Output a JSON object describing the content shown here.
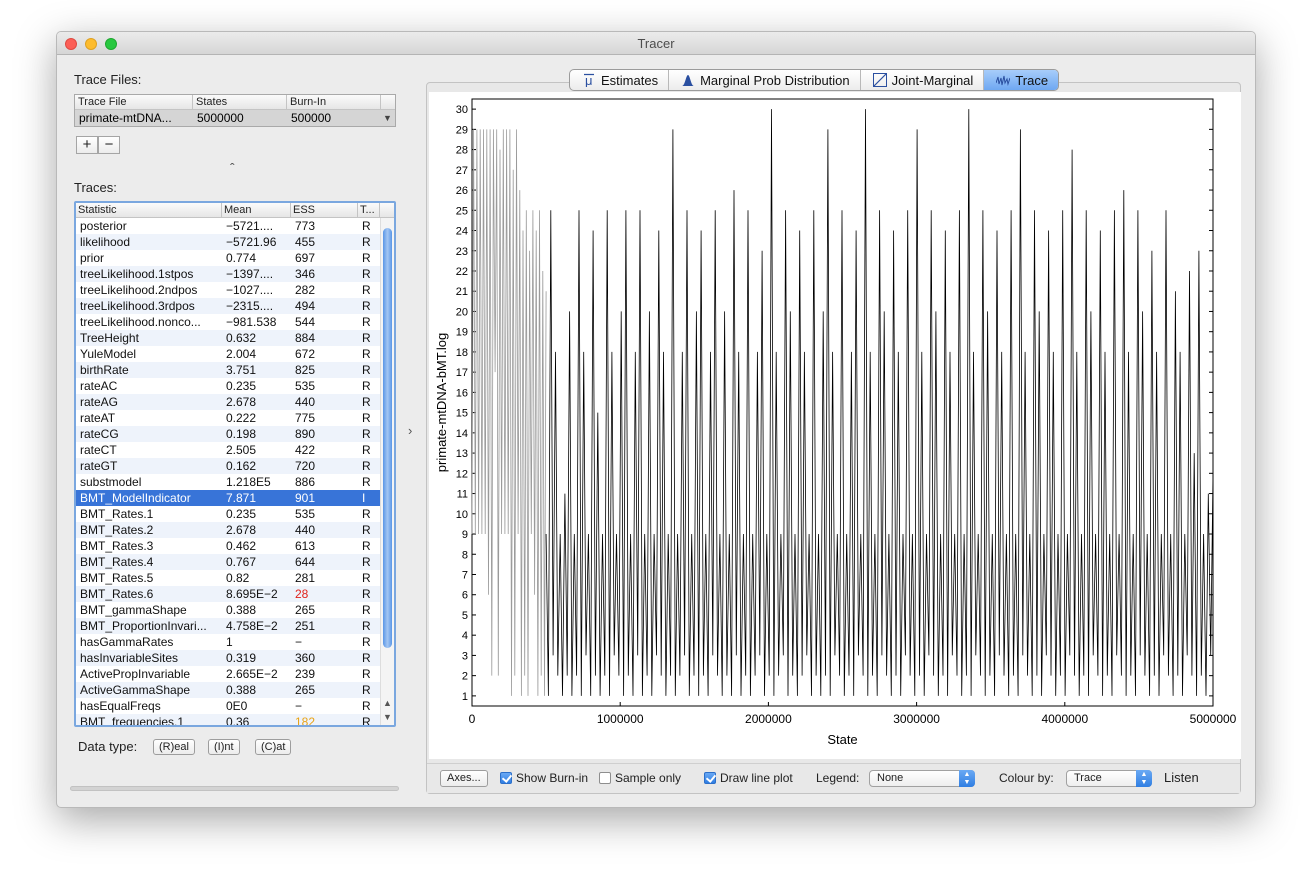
{
  "window": {
    "title": "Tracer"
  },
  "left": {
    "trace_files_label": "Trace Files:",
    "files_columns": [
      "Trace File",
      "States",
      "Burn-In"
    ],
    "files_rows": [
      {
        "file": "primate-mtDNA...",
        "states": "5000000",
        "burnin": "500000"
      }
    ],
    "add_label": "+",
    "remove_label": "−",
    "collapse_glyph": "ˆ",
    "traces_label": "Traces:",
    "traces_columns": [
      "Statistic",
      "Mean",
      "ESS",
      "T..."
    ],
    "traces_rows": [
      {
        "stat": "posterior",
        "mean": "−5721....",
        "ess": "773",
        "type": "R"
      },
      {
        "stat": "likelihood",
        "mean": "−5721.96",
        "ess": "455",
        "type": "R"
      },
      {
        "stat": "prior",
        "mean": "0.774",
        "ess": "697",
        "type": "R"
      },
      {
        "stat": "treeLikelihood.1stpos",
        "mean": "−1397....",
        "ess": "346",
        "type": "R"
      },
      {
        "stat": "treeLikelihood.2ndpos",
        "mean": "−1027....",
        "ess": "282",
        "type": "R"
      },
      {
        "stat": "treeLikelihood.3rdpos",
        "mean": "−2315....",
        "ess": "494",
        "type": "R"
      },
      {
        "stat": "treeLikelihood.nonco...",
        "mean": "−981.538",
        "ess": "544",
        "type": "R"
      },
      {
        "stat": "TreeHeight",
        "mean": "0.632",
        "ess": "884",
        "type": "R"
      },
      {
        "stat": "YuleModel",
        "mean": "2.004",
        "ess": "672",
        "type": "R"
      },
      {
        "stat": "birthRate",
        "mean": "3.751",
        "ess": "825",
        "type": "R"
      },
      {
        "stat": "rateAC",
        "mean": "0.235",
        "ess": "535",
        "type": "R"
      },
      {
        "stat": "rateAG",
        "mean": "2.678",
        "ess": "440",
        "type": "R"
      },
      {
        "stat": "rateAT",
        "mean": "0.222",
        "ess": "775",
        "type": "R"
      },
      {
        "stat": "rateCG",
        "mean": "0.198",
        "ess": "890",
        "type": "R"
      },
      {
        "stat": "rateCT",
        "mean": "2.505",
        "ess": "422",
        "type": "R"
      },
      {
        "stat": "rateGT",
        "mean": "0.162",
        "ess": "720",
        "type": "R"
      },
      {
        "stat": "substmodel",
        "mean": "1.218E5",
        "ess": "886",
        "type": "R"
      },
      {
        "stat": "BMT_ModelIndicator",
        "mean": "7.871",
        "ess": "901",
        "type": "I",
        "selected": true
      },
      {
        "stat": "BMT_Rates.1",
        "mean": "0.235",
        "ess": "535",
        "type": "R"
      },
      {
        "stat": "BMT_Rates.2",
        "mean": "2.678",
        "ess": "440",
        "type": "R"
      },
      {
        "stat": "BMT_Rates.3",
        "mean": "0.462",
        "ess": "613",
        "type": "R"
      },
      {
        "stat": "BMT_Rates.4",
        "mean": "0.767",
        "ess": "644",
        "type": "R"
      },
      {
        "stat": "BMT_Rates.5",
        "mean": "0.82",
        "ess": "281",
        "type": "R"
      },
      {
        "stat": "BMT_Rates.6",
        "mean": "8.695E−2",
        "ess": "28",
        "type": "R",
        "ess_color": "red"
      },
      {
        "stat": "BMT_gammaShape",
        "mean": "0.388",
        "ess": "265",
        "type": "R"
      },
      {
        "stat": "BMT_ProportionInvari...",
        "mean": "4.758E−2",
        "ess": "251",
        "type": "R"
      },
      {
        "stat": "hasGammaRates",
        "mean": "1",
        "ess": "−",
        "type": "R"
      },
      {
        "stat": "hasInvariableSites",
        "mean": "0.319",
        "ess": "360",
        "type": "R"
      },
      {
        "stat": "ActivePropInvariable",
        "mean": "2.665E−2",
        "ess": "239",
        "type": "R"
      },
      {
        "stat": "ActiveGammaShape",
        "mean": "0.388",
        "ess": "265",
        "type": "R"
      },
      {
        "stat": "hasEqualFreqs",
        "mean": "0E0",
        "ess": "−",
        "type": "R"
      },
      {
        "stat": "BMT_frequencies.1",
        "mean": "0.36",
        "ess": "182",
        "type": "R",
        "ess_color": "orange"
      }
    ],
    "data_type_label": "Data type:",
    "data_type_buttons": [
      "(R)eal",
      "(I)nt",
      "(C)at"
    ],
    "split_glyph": "›"
  },
  "tabs": [
    {
      "label": "Estimates",
      "icon": "mu-icon"
    },
    {
      "label": "Marginal Prob Distribution",
      "icon": "density-icon"
    },
    {
      "label": "Joint-Marginal",
      "icon": "joint-icon"
    },
    {
      "label": "Trace",
      "icon": "trace-icon",
      "active": true
    }
  ],
  "controls": {
    "axes_label": "Axes...",
    "show_burnin_label": "Show Burn-in",
    "show_burnin_checked": true,
    "sample_only_label": "Sample only",
    "sample_only_checked": false,
    "draw_line_label": "Draw line plot",
    "draw_line_checked": true,
    "legend_label": "Legend:",
    "legend_value": "None",
    "colour_by_label": "Colour by:",
    "colour_by_value": "Trace",
    "listen_label": "Listen"
  },
  "chart_data": {
    "type": "line",
    "xlabel": "State",
    "ylabel": "primate-mtDNA-bMT.log",
    "xlim": [
      0,
      5000000
    ],
    "ylim": [
      0.5,
      30.5
    ],
    "x_ticks": [
      "0",
      "1000000",
      "2000000",
      "3000000",
      "4000000",
      "5000000"
    ],
    "y_ticks": [
      "1",
      "2",
      "3",
      "4",
      "5",
      "6",
      "7",
      "8",
      "9",
      "10",
      "11",
      "12",
      "13",
      "14",
      "15",
      "16",
      "17",
      "18",
      "19",
      "20",
      "21",
      "22",
      "23",
      "24",
      "25",
      "26",
      "27",
      "28",
      "29",
      "30"
    ],
    "burnin": 500000,
    "series": [
      {
        "values_burnin": [
          9,
          29,
          9,
          29,
          9,
          29,
          9,
          29,
          9,
          29,
          6,
          29,
          2,
          29,
          17,
          29,
          2,
          28,
          9,
          29,
          9,
          29,
          9,
          29,
          1,
          27,
          2,
          29,
          9,
          26,
          1,
          24,
          2,
          25,
          1,
          23,
          9,
          25,
          6,
          24,
          1,
          25,
          2,
          22,
          1,
          21
        ],
        "values": [
          9,
          1,
          25,
          3,
          18,
          2,
          9,
          1,
          11,
          2,
          20,
          1,
          9,
          2,
          25,
          1,
          18,
          3,
          9,
          1,
          24,
          2,
          15,
          1,
          9,
          2,
          25,
          1,
          18,
          3,
          9,
          2,
          20,
          1,
          25,
          2,
          9,
          1,
          18,
          3,
          25,
          1,
          9,
          2,
          20,
          1,
          9,
          3,
          24,
          2,
          18,
          1,
          9,
          2,
          29,
          1,
          9,
          2,
          18,
          3,
          25,
          1,
          9,
          2,
          20,
          1,
          24,
          2,
          9,
          1,
          18,
          3,
          25,
          2,
          9,
          1,
          20,
          2,
          9,
          1,
          26,
          3,
          18,
          1,
          9,
          2,
          25,
          1,
          9,
          2,
          18,
          3,
          23,
          1,
          9,
          2,
          30,
          1,
          18,
          2,
          9,
          3,
          25,
          1,
          20,
          2,
          9,
          1,
          24,
          2,
          18,
          3,
          9,
          1,
          25,
          2,
          9,
          1,
          20,
          2,
          29,
          1,
          18,
          3,
          9,
          2,
          25,
          1,
          9,
          2,
          18,
          1,
          24,
          3,
          9,
          2,
          30,
          1,
          18,
          2,
          9,
          1,
          25,
          3,
          20,
          2,
          9,
          1,
          24,
          2,
          18,
          1,
          9,
          3,
          25,
          2,
          9,
          1,
          29,
          2,
          18,
          1,
          9,
          3,
          25,
          2,
          20,
          1,
          9,
          2,
          24,
          1,
          18,
          3,
          9,
          2,
          25,
          1,
          9,
          2,
          30,
          1,
          18,
          3,
          9,
          2,
          25,
          1,
          20,
          2,
          9,
          1,
          24,
          3,
          18,
          2,
          9,
          1,
          25,
          2,
          9,
          1,
          29,
          3,
          18,
          2,
          9,
          1,
          25,
          2,
          20,
          1,
          9,
          3,
          24,
          2,
          18,
          1,
          9,
          2,
          25,
          1,
          9,
          3,
          28,
          2,
          18,
          1,
          9,
          2,
          25,
          1,
          20,
          3,
          9,
          2,
          24,
          1,
          18,
          2,
          9,
          1,
          25,
          3,
          9,
          2,
          26,
          1,
          18,
          2,
          9,
          1,
          25,
          3,
          20,
          2,
          9,
          1,
          23,
          2,
          18,
          1,
          9,
          3,
          25,
          2,
          9,
          1,
          21,
          2,
          18,
          1,
          9,
          3,
          22,
          2,
          13,
          1,
          23,
          2,
          9,
          1,
          11,
          3,
          12
        ]
      }
    ]
  }
}
